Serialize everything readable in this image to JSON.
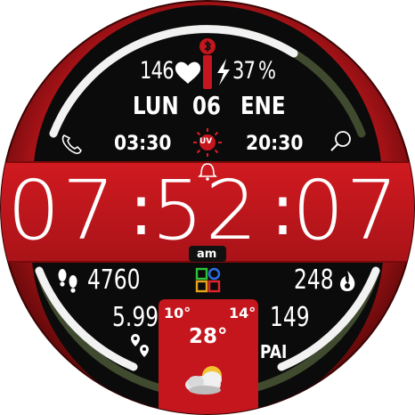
{
  "colors": {
    "accent_red": "#c4161c",
    "dark_red": "#6e0a0a",
    "inner_black": "#0b0b0b",
    "ring_olive": "#3f4a2e",
    "text_white": "#ffffff"
  },
  "status": {
    "heart_rate": "146",
    "battery_percent": "37",
    "battery_unit": "%"
  },
  "date": {
    "weekday": "LUN",
    "day": "06",
    "month": "ENE"
  },
  "shortcuts": {
    "left_time": "03:30",
    "right_time": "20:30",
    "uv_label": "UV"
  },
  "clock": {
    "hours": "07",
    "minutes": "52",
    "seconds": "07",
    "ampm": "am"
  },
  "stats": {
    "steps": "4760",
    "calories": "248",
    "distance": "5.99",
    "pai_value": "149",
    "pai_label": "PAI"
  },
  "weather": {
    "temp_low": "10°",
    "temp_high": "14°",
    "temp_current": "28°"
  },
  "icons": {
    "bluetooth": "bluetooth-icon",
    "heart": "heart-icon",
    "bolt": "bolt-icon",
    "phone": "phone-icon",
    "search": "search-icon",
    "sun": "sun-icon",
    "alarm": "bell-icon",
    "footprints": "footprints-icon",
    "flame": "flame-icon",
    "location": "location-pins-icon",
    "apps": "apps-grid-icon",
    "weather": "partly-cloudy-icon"
  }
}
